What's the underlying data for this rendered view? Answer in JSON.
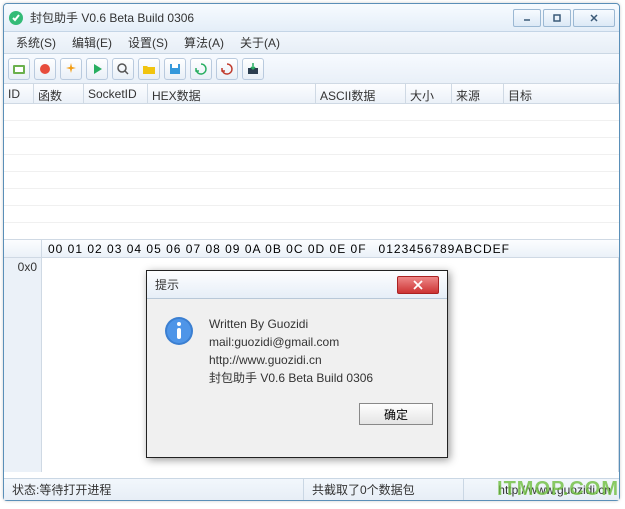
{
  "window": {
    "title": "封包助手 V0.6 Beta Build 0306"
  },
  "menu": {
    "system": "系统(S)",
    "edit": "编辑(E)",
    "settings": "设置(S)",
    "algorithm": "算法(A)",
    "about": "关于(A)"
  },
  "grid": {
    "cols": {
      "id": "ID",
      "func": "函数",
      "socketid": "SocketID",
      "hexdata": "HEX数据",
      "asciidata": "ASCII数据",
      "size": "大小",
      "source": "来源",
      "target": "目标"
    }
  },
  "hex": {
    "header_bytes": "00 01 02 03 04 05 06 07 08 09 0A 0B 0C 0D 0E 0F",
    "header_ascii": "0123456789ABCDEF",
    "addr0": "0x0"
  },
  "status": {
    "left": "状态:等待打开进程",
    "center": "共截取了0个数据包",
    "url": "http://www.guozidi.cn"
  },
  "dialog": {
    "title": "提示",
    "line1": "Written By Guozidi",
    "line2": "mail:guozidi@gmail.com",
    "line3": "http://www.guozidi.cn",
    "line4": "封包助手 V0.6 Beta Build 0306",
    "ok": "确定"
  },
  "watermark": "ITMOP.COM"
}
